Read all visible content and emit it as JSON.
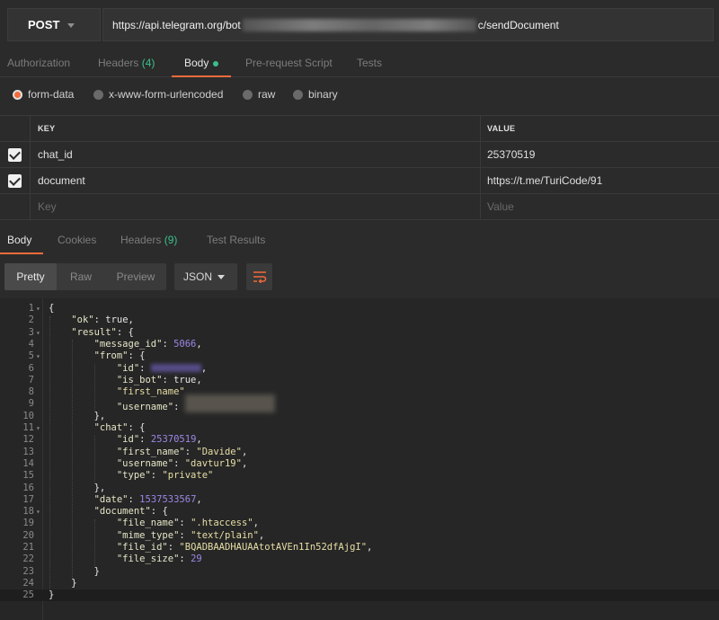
{
  "request": {
    "method": "POST",
    "url_prefix": "https://api.telegram.org/bot",
    "url_suffix": "c/sendDocument"
  },
  "request_tabs": [
    {
      "label": "Authorization"
    },
    {
      "label": "Headers",
      "count": "(4)"
    },
    {
      "label": "Body"
    },
    {
      "label": "Pre-request Script"
    },
    {
      "label": "Tests"
    }
  ],
  "body_types": [
    "form-data",
    "x-www-form-urlencoded",
    "raw",
    "binary"
  ],
  "params": {
    "key_header": "KEY",
    "value_header": "VALUE",
    "rows": [
      {
        "key": "chat_id",
        "value": "25370519"
      },
      {
        "key": "document",
        "value": "https://t.me/TuriCode/91"
      }
    ],
    "key_placeholder": "Key",
    "value_placeholder": "Value"
  },
  "response_tabs": [
    {
      "label": "Body"
    },
    {
      "label": "Cookies"
    },
    {
      "label": "Headers",
      "count": "(9)"
    },
    {
      "label": "Test Results"
    }
  ],
  "view_modes": [
    "Pretty",
    "Raw",
    "Preview"
  ],
  "format": "JSON",
  "icons": {
    "method_dropdown": "chevron-down-icon",
    "wrap": "wrap-lines-icon",
    "checkbox": "check-icon"
  },
  "colors": {
    "accent": "#f26b3a",
    "green": "#3ac08c",
    "number": "#9d87e6",
    "string": "#e8dfa6"
  },
  "code_lines": [
    {
      "n": "1",
      "fold": true,
      "t": "{"
    },
    {
      "n": "2",
      "t": "    \"ok\": true,"
    },
    {
      "n": "3",
      "fold": true,
      "t": "    \"result\": {"
    },
    {
      "n": "4",
      "t": "        \"message_id\": 5066,"
    },
    {
      "n": "5",
      "fold": true,
      "t": "        \"from\": {"
    },
    {
      "n": "6",
      "t": "            \"id\": ,"
    },
    {
      "n": "7",
      "t": "            \"is_bot\": true,"
    },
    {
      "n": "8",
      "t": "            \"first_name\""
    },
    {
      "n": "9",
      "t": "            \"username\": "
    },
    {
      "n": "10",
      "t": "        },"
    },
    {
      "n": "11",
      "fold": true,
      "t": "        \"chat\": {"
    },
    {
      "n": "12",
      "t": "            \"id\": 25370519,"
    },
    {
      "n": "13",
      "t": "            \"first_name\": \"Davide\","
    },
    {
      "n": "14",
      "t": "            \"username\": \"davtur19\","
    },
    {
      "n": "15",
      "t": "            \"type\": \"private\""
    },
    {
      "n": "16",
      "t": "        },"
    },
    {
      "n": "17",
      "t": "        \"date\": 1537533567,"
    },
    {
      "n": "18",
      "fold": true,
      "t": "        \"document\": {"
    },
    {
      "n": "19",
      "t": "            \"file_name\": \".htaccess\","
    },
    {
      "n": "20",
      "t": "            \"mime_type\": \"text/plain\","
    },
    {
      "n": "21",
      "t": "            \"file_id\": \"BQADBAADHAUAAtotAVEn1In52dfAjgI\","
    },
    {
      "n": "22",
      "t": "            \"file_size\": 29"
    },
    {
      "n": "23",
      "t": "        }"
    },
    {
      "n": "24",
      "t": "    }"
    },
    {
      "n": "25",
      "t": "}"
    }
  ]
}
